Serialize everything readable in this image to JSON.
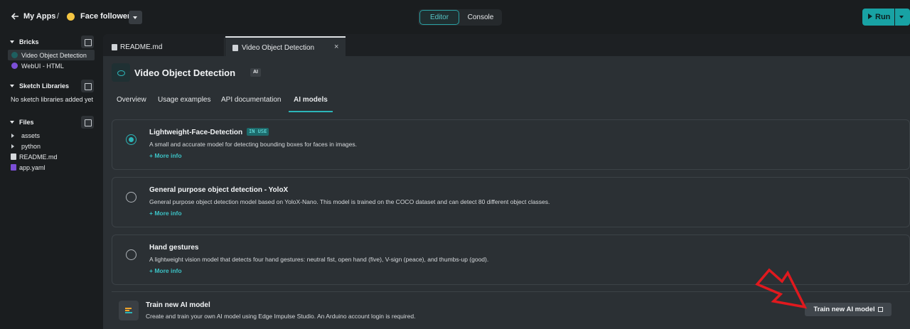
{
  "header": {
    "my_apps": "My Apps",
    "separator": "/",
    "app_name": "Face follower",
    "mode_editor": "Editor",
    "mode_console": "Console",
    "run_label": "Run"
  },
  "sidebar": {
    "bricks_title": "Bricks",
    "bricks": [
      {
        "label": "Video Object Detection",
        "icon": "eye-icon",
        "color": "#2cb5b8"
      },
      {
        "label": "WebUI - HTML",
        "icon": "web-icon",
        "color": "#7b4fd6"
      }
    ],
    "sketch_title": "Sketch Libraries",
    "sketch_empty": "No sketch libraries added yet",
    "files_title": "Files",
    "files": [
      {
        "label": "assets",
        "type": "folder"
      },
      {
        "label": "python",
        "type": "folder"
      },
      {
        "label": "README.md",
        "type": "file"
      },
      {
        "label": "app.yaml",
        "type": "yaml"
      }
    ]
  },
  "editor_tabs": [
    {
      "label": "README.md"
    },
    {
      "label": "Video Object Detection",
      "close": "×"
    }
  ],
  "brick": {
    "title": "Video Object Detection",
    "tag": "AI",
    "tabs": [
      "Overview",
      "Usage examples",
      "API documentation",
      "AI models"
    ],
    "active_tab": "AI models"
  },
  "models": [
    {
      "title": "Lightweight-Face-Detection",
      "badge": "IN USE",
      "desc": "A small and accurate model for detecting bounding boxes for faces in images.",
      "more": "+ More info",
      "selected": true
    },
    {
      "title": "General purpose object detection - YoloX",
      "desc": "General purpose object detection model based on YoloX-Nano. This model is trained on the COCO dataset and can detect 80 different object classes.",
      "more": "+ More info",
      "selected": false
    },
    {
      "title": "Hand gestures",
      "desc": "A lightweight vision model that detects four hand gestures: neutral fist, open hand (five), V-sign (peace), and thumbs-up (good).",
      "more": "+ More info",
      "selected": false
    }
  ],
  "train": {
    "title": "Train new AI model",
    "desc": "Create and train your own AI model using Edge Impulse Studio. An Arduino account login is required.",
    "button": "Train new AI model"
  },
  "colors": {
    "accent": "#2cb5b8",
    "annotation_arrow": "#e0191e"
  }
}
